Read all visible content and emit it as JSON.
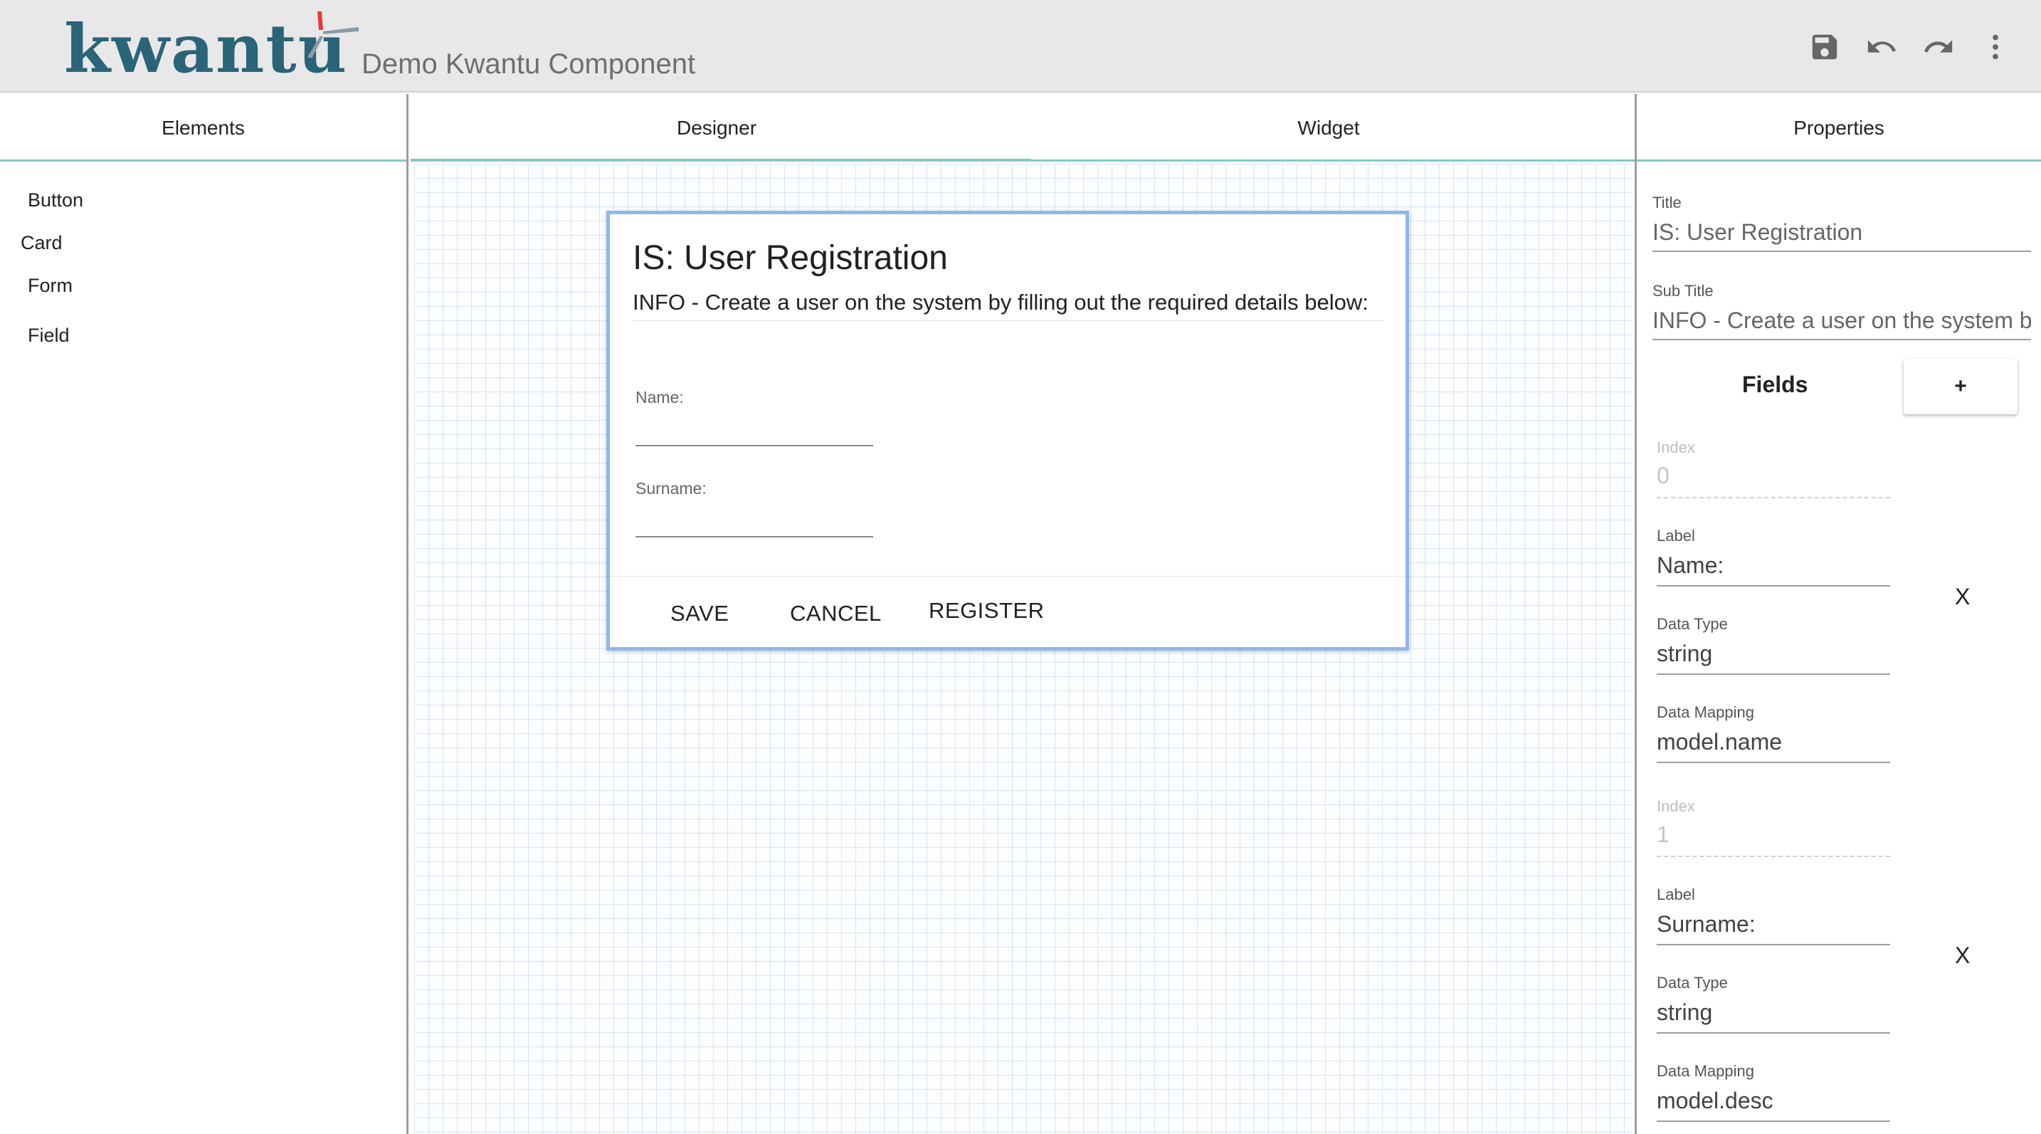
{
  "header": {
    "logo_text": "kwantu",
    "app_title": "Demo Kwantu Component",
    "icons": [
      "save-icon",
      "undo-icon",
      "redo-icon",
      "more-vert-icon"
    ],
    "logo_colors": {
      "text": "#2a6478",
      "mark_red": "#e53935",
      "mark_gray": "#8a9aa6"
    }
  },
  "left_panel": {
    "tab": "Elements",
    "items": [
      "Button",
      "Card",
      "Form",
      "Field"
    ]
  },
  "center_panel": {
    "tabs": [
      "Designer",
      "Widget"
    ],
    "active_tab": "Designer",
    "card": {
      "title": "IS: User Registration",
      "subtitle": "INFO - Create a user on the system by filling out the required details below:",
      "fields": [
        {
          "label": "Name:"
        },
        {
          "label": "Surname:"
        }
      ],
      "buttons": [
        "SAVE",
        "CANCEL",
        "REGISTER"
      ]
    }
  },
  "right_panel": {
    "tab": "Properties",
    "title_label": "Title",
    "title_value": "IS: User Registration",
    "subtitle_label": "Sub Title",
    "subtitle_value": "INFO - Create a user on the system by filling out the required details below:",
    "fields_heading": "Fields",
    "add_label": "+",
    "remove_label": "X",
    "field_props": [
      {
        "index_label": "Index",
        "index_value": "0",
        "label_label": "Label",
        "label_value": "Name:",
        "type_label": "Data Type",
        "type_value": "string",
        "mapping_label": "Data Mapping",
        "mapping_value": "model.name"
      },
      {
        "index_label": "Index",
        "index_value": "1",
        "label_label": "Label",
        "label_value": "Surname:",
        "type_label": "Data Type",
        "type_value": "string",
        "mapping_label": "Data Mapping",
        "mapping_value": "model.desc"
      }
    ]
  },
  "colors": {
    "tab_accent": "#80cbc4",
    "card_border": "#8db9e8",
    "header_bg": "#e8e8e8"
  }
}
